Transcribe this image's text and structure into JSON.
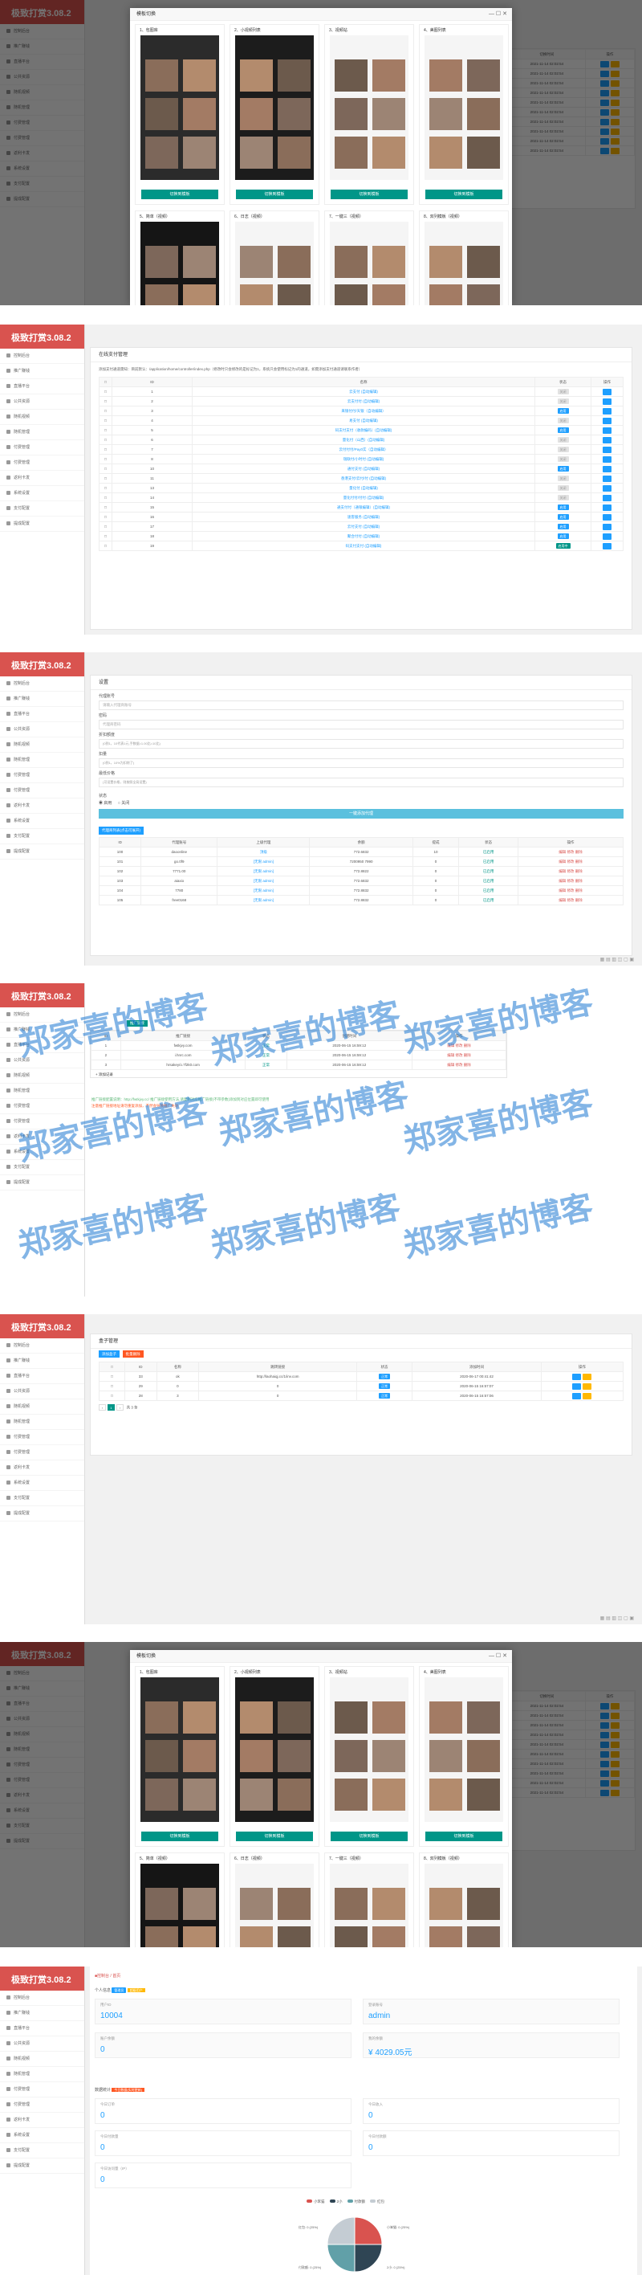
{
  "app": {
    "logo": "极致打赏3.08.2"
  },
  "nav": [
    "控制后台",
    "推广赚钱",
    "直播平台",
    "公共资源",
    "随机视频",
    "随机管理",
    "付费管理",
    "付费管理",
    "返利卡发",
    "系统设置",
    "支付配置",
    "提成配置"
  ],
  "modal": {
    "title": "模板切换",
    "templates": [
      {
        "name": "1、包图库",
        "btn": "切换到模板"
      },
      {
        "name": "2、小视频列表",
        "btn": "切换到模板"
      },
      {
        "name": "3、视频站",
        "btn": "切换到模板"
      },
      {
        "name": "4、美图列表",
        "btn": "切换到模板"
      },
      {
        "name": "5、简单（视频）",
        "btn": "切换到模板"
      },
      {
        "name": "6、日志（视频）",
        "btn": "切换到模板"
      },
      {
        "name": "7、一键三（视频）",
        "btn": "切换到模板"
      },
      {
        "name": "8、双列模板（视频）",
        "btn": "切换到模板"
      }
    ],
    "bg_header": [
      "切换时间",
      "操作"
    ],
    "bg_rows": [
      "2021-11-14 02:02:54",
      "2021-11-14 02:02:54",
      "2021-11-14 02:02:54",
      "2021-11-14 02:02:54",
      "2021-11-14 02:02:54",
      "2021-11-14 02:02:54",
      "2021-11-14 02:02:54",
      "2021-11-14 02:02:54",
      "2021-11-14 02:02:54",
      "2021-11-14 02:02:54"
    ]
  },
  "panel2": {
    "title": "在线支付管理",
    "note": "添加支付通道需知：目前默认：/application/home/controller/index.php（修改时只会修改的是标记为1，系统只会使用标记为1的通道，如需添加支付通道请联系作者）",
    "headers": [
      "ID",
      "名称",
      "状态",
      "操作"
    ],
    "rows": [
      {
        "id": "1",
        "name": "云支付 (自动编辑)",
        "state": "关闭"
      },
      {
        "id": "2",
        "name": "云支付付 (自动编辑)",
        "state": "关闭"
      },
      {
        "id": "3",
        "name": "来银付付/天银（自动编辑）",
        "state": "启用"
      },
      {
        "id": "4",
        "name": "易支付 (自动编辑)",
        "state": "关闭"
      },
      {
        "id": "5",
        "name": "码支付支付（收款编码）(自动编辑)",
        "state": "启用"
      },
      {
        "id": "6",
        "name": "量化付（山西）(自动编辑)",
        "state": "关闭"
      },
      {
        "id": "7",
        "name": "云付付付/Pay0实（自动编辑）",
        "state": "关闭"
      },
      {
        "id": "8",
        "name": "瑞联付/小时付 (自动编辑)",
        "state": "关闭"
      },
      {
        "id": "10",
        "name": "通付支付 (自动编辑)",
        "state": "启用"
      },
      {
        "id": "11",
        "name": "香港支付/云付/付 (自动编辑)",
        "state": "关闭"
      },
      {
        "id": "13",
        "name": "量化付 (自动编辑)",
        "state": "关闭"
      },
      {
        "id": "14",
        "name": "量化付付/付付 (自动编辑)",
        "state": "关闭"
      },
      {
        "id": "15",
        "name": "通支付付（通银编辑）(自动编辑)",
        "state": "启用"
      },
      {
        "id": "16",
        "name": "速客服务 (自动编辑)",
        "state": "启用"
      },
      {
        "id": "17",
        "name": "云付支付 (自动编辑)",
        "state": "启用"
      },
      {
        "id": "18",
        "name": "聚合付付 (自动编辑)",
        "state": "启用"
      },
      {
        "id": "19",
        "name": "码支付支付 (自动编辑)",
        "state": "启用中"
      }
    ]
  },
  "panel3": {
    "title": "设置",
    "fields": [
      {
        "label": "代理账号",
        "value": "请输入代理商账号"
      },
      {
        "label": "密码",
        "value": "代理商密码"
      },
      {
        "label": "折扣额度",
        "tip": "(0到1，10代表1元,手数据=1.00比=10比)"
      },
      {
        "label": "扣量",
        "tip": "(0到1，10%为扣除了)"
      },
      {
        "label": "最低价格",
        "tip": "(可设置价格，则按照全局设置)"
      }
    ],
    "status_label": "状态",
    "radio_on": "启用",
    "radio_off": "关闭",
    "submit": "一键添加代理",
    "list_title": "代理商列表(点击可展开)",
    "headers": [
      "ID",
      "代理账号",
      "上级代理",
      "余额",
      "提成",
      "状态",
      "操作"
    ],
    "rows": [
      {
        "id": "100",
        "acc": "daoonline",
        "up": "顶级",
        "bal": "772.6832",
        "rate": "10",
        "st": "已启用",
        "op": "编辑 修改 删除"
      },
      {
        "id": "101",
        "acc": "go.0f9",
        "up": "[无限 admin]",
        "bal": "7200950 7990",
        "rate": "0",
        "st": "已启用",
        "op": "编辑 修改 删除"
      },
      {
        "id": "102",
        "acc": "7771.00",
        "up": "[无限 admin]",
        "bal": "772.8822",
        "rate": "0",
        "st": "已启用",
        "op": "编辑 修改 删除"
      },
      {
        "id": "103",
        "acc": "aiaxio",
        "up": "[无限 admin]",
        "bal": "772.6832",
        "rate": "0",
        "st": "已启用",
        "op": "编辑 修改 删除"
      },
      {
        "id": "104",
        "acc": "7780",
        "up": "[无限 admin]",
        "bal": "772.8832",
        "rate": "0",
        "st": "已启用",
        "op": "编辑 修改 删除"
      },
      {
        "id": "105",
        "acc": "free0168",
        "up": "[无限 admin]",
        "bal": "772.8832",
        "rate": "0",
        "st": "已启用",
        "op": "编辑 修改 删除"
      }
    ]
  },
  "panel4": {
    "tab": "推广链接",
    "headers": [
      "ID",
      "推广链接",
      "状态",
      "创建时间",
      "操作"
    ],
    "rows": [
      {
        "id": "1",
        "link": "fwtkjvy.com",
        "st": "正常",
        "time": "2020-06-15 16:59:12",
        "op": "编辑 修改 删除"
      },
      {
        "id": "2",
        "link": "i.hnrc.com",
        "st": "正常",
        "time": "2020-06-15 16:59:12",
        "op": "编辑 修改 删除"
      },
      {
        "id": "3",
        "link": "hrsakey/o.7f2k0.com",
        "st": "正常",
        "time": "2020-06-15 16:59:12",
        "op": "编辑 修改 删除"
      }
    ],
    "add": "+ 添加记录",
    "note1": "推广链接配置说明：http://fwtkjvy.cc/ 推广链接使用方法,请复制对应推广链接(不带参数)添加到对应位置即可使用",
    "note2": "注意推广链接地址请勿重复添加，不然会导致推广失效"
  },
  "watermark": "郑家喜的博客",
  "panel5": {
    "title": "盒子管理",
    "btn_add": "添加盒子",
    "btn_del": "批量删除",
    "headers": [
      "ID",
      "名称",
      "跳转链接",
      "状态",
      "添加时间",
      "操作"
    ],
    "rows": [
      {
        "id": "33",
        "name": "ok",
        "link": "http://laohaiqj.cc/1/inv.com",
        "st": "正常",
        "time": "2020-06-17 00:41:42"
      },
      {
        "id": "29",
        "name": "0",
        "link": "0",
        "st": "正常",
        "time": "2020-06-15 16:57:07"
      },
      {
        "id": "28",
        "name": "3",
        "link": "0",
        "st": "正常",
        "time": "2020-06-15 16:57:06"
      }
    ],
    "pager": "共 3 条"
  },
  "panel7": {
    "breadcrumb": "■控制台 / 首页",
    "sec1": "个人信息",
    "badge1": "管理员",
    "badge2": "超级用户",
    "stats": [
      {
        "k": "用户ID",
        "v": "10004"
      },
      {
        "k": "登录账号",
        "v": "admin"
      },
      {
        "k": "账户余额",
        "v": "0"
      },
      {
        "k": "我的余额",
        "v": "¥ 4029.05元"
      }
    ],
    "sec2": "数据统计",
    "badge3": "今日数据(实时更新)",
    "stats2": [
      {
        "k": "今日订单",
        "v": "0"
      },
      {
        "k": "今日收入",
        "v": "0"
      },
      {
        "k": "今日付款量",
        "v": "0"
      },
      {
        "k": "今日付款额",
        "v": "0"
      },
      {
        "k": "今日访问量（IP）",
        "v": "0"
      }
    ],
    "legend": [
      "小笨猫",
      "2小",
      "付款额",
      "红包"
    ],
    "chart_data": {
      "type": "pie",
      "series": [
        {
          "name": "小笨猫",
          "value": 25,
          "color": "#d9534f"
        },
        {
          "name": "2小",
          "value": 25,
          "color": "#2f4554"
        },
        {
          "name": "付款额",
          "value": 25,
          "color": "#61a0a8"
        },
        {
          "name": "红包",
          "value": 25,
          "color": "#c4ccd3"
        }
      ],
      "labels": [
        "红包: 0 (25%)",
        "小笨猫: 0 (25%)",
        "付款额: 0 (25%)",
        "2小: 0 (25%)"
      ]
    }
  }
}
